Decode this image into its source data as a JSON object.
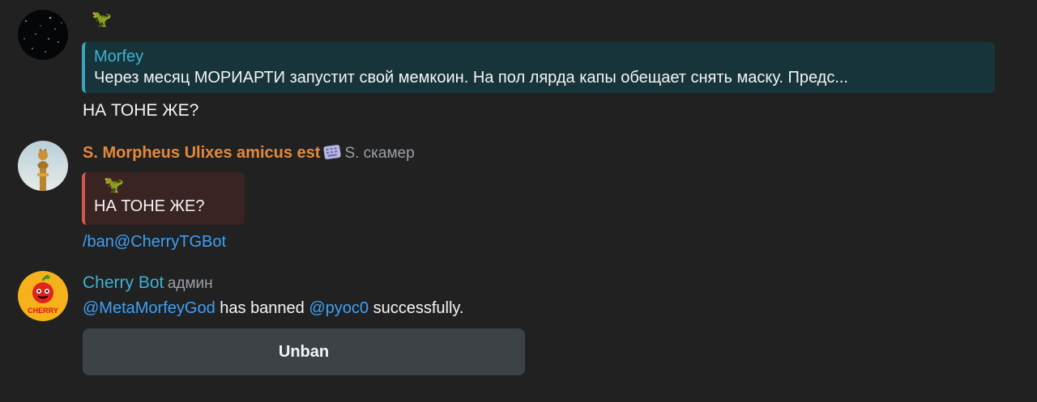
{
  "messages": [
    {
      "avatar_icon": "starfield-avatar-icon",
      "emoji": "🦖",
      "reply": {
        "author": "Morfey",
        "text": "Через месяц МОРИАРТИ запустит свой мемкоин. На пол лярда капы обещает снять маску.   Предс..."
      },
      "text": "НА ТОНЕ ЖЕ?"
    },
    {
      "avatar_icon": "golden-statue-avatar-icon",
      "sender": "S. Morpheus Ulixes amicus est",
      "sender_badge_icon": "keyboard-sticker-icon",
      "sender_role": "S. скамер",
      "reply": {
        "emoji": "🦖",
        "text": "НА ТОНЕ ЖЕ?"
      },
      "command": "/ban@CherryTGBot"
    },
    {
      "avatar_icon": "cherry-logo-avatar-icon",
      "avatar_label": "CHERRY",
      "sender": "Cherry Bot",
      "sender_role": "админ",
      "text_parts": {
        "mention1": "@MetaMorfeyGod",
        "middle": " has banned ",
        "mention2": "@pyoc0",
        "end": " successfully."
      },
      "button": "Unban"
    }
  ],
  "colors": {
    "background": "#212121",
    "reply_accent_blue": "#3aa3c0",
    "reply_accent_red": "#d4574f",
    "sender_orange": "#e38a3a",
    "sender_teal": "#3cb3d4",
    "link_blue": "#3ea0f5",
    "button_bg": "#3d4247"
  }
}
